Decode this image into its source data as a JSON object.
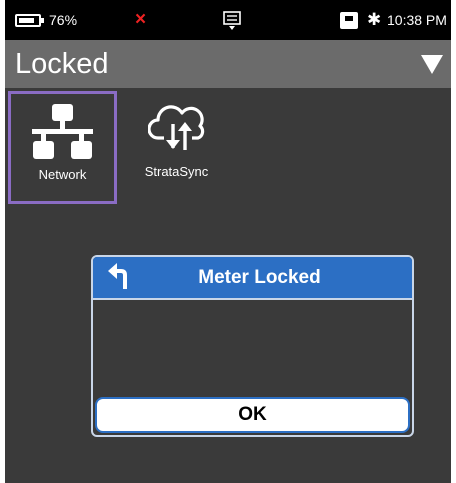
{
  "status_bar": {
    "battery_text": "76%",
    "error_icon": "×",
    "bluetooth_icon": "✱",
    "time": "10:38 PM"
  },
  "title_bar": {
    "title": "Locked"
  },
  "apps": [
    {
      "label": "Network",
      "icon": "network-icon",
      "selected": true
    },
    {
      "label": "StrataSync",
      "icon": "cloud-sync-icon",
      "selected": false
    }
  ],
  "dialog": {
    "title": "Meter Locked",
    "ok_label": "OK"
  },
  "colors": {
    "screen_bg": "#3a3a3a",
    "title_bar_bg": "#6b6b6b",
    "selection_border": "#8a6cc4",
    "dialog_header": "#2c6fc4",
    "error": "#e22222"
  }
}
